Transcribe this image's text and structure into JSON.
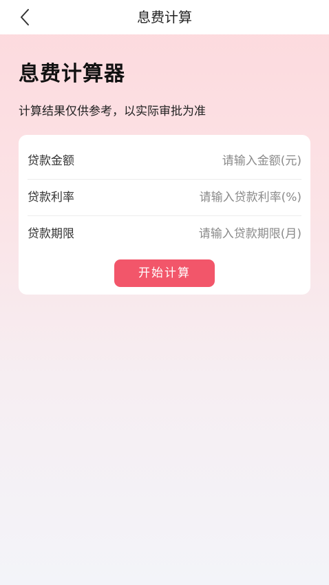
{
  "nav": {
    "title": "息费计算",
    "back_icon": "chevron-left-icon"
  },
  "hero": {
    "title": "息费计算器",
    "subtitle": "计算结果仅供参考，以实际审批为准"
  },
  "form": {
    "fields": [
      {
        "label": "贷款金额",
        "value": "",
        "placeholder": "请输入金额(元)"
      },
      {
        "label": "贷款利率",
        "value": "",
        "placeholder": "请输入贷款利率(%)"
      },
      {
        "label": "贷款期限",
        "value": "",
        "placeholder": "请输入贷款期限(月)"
      }
    ],
    "submit_label": "开始计算"
  },
  "colors": {
    "accent": "#f2566a",
    "background_top": "#fdd9dd",
    "background_bottom": "#f3f4f9"
  }
}
